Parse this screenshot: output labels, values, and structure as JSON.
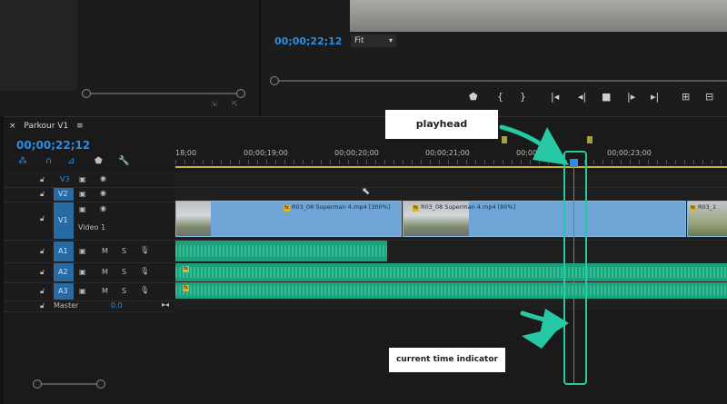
{
  "program_monitor": {
    "timecode": "00;00;22;12",
    "zoom": "Fit",
    "transport_icons": [
      "marker-icon",
      "mark-in-icon",
      "mark-out-icon",
      "go-to-in-icon",
      "step-back-icon",
      "stop-icon",
      "step-forward-icon",
      "go-to-out-icon",
      "lift-icon",
      "extract-icon"
    ]
  },
  "timeline": {
    "sequence_name": "Parkour V1",
    "timecode": "00;00;22;12",
    "ruler_labels": [
      "18;00",
      "00;00;19;00",
      "00;00;20;00",
      "00;00;21;00",
      "00;00;22;00",
      "00;00;23;00"
    ],
    "tracks": [
      {
        "id": "V3",
        "type": "video",
        "label": ""
      },
      {
        "id": "V2",
        "type": "video",
        "label": ""
      },
      {
        "id": "V1",
        "type": "video",
        "label": "Video 1"
      },
      {
        "id": "A1",
        "type": "audio",
        "m": "M",
        "s": "S"
      },
      {
        "id": "A2",
        "type": "audio",
        "m": "M",
        "s": "S"
      },
      {
        "id": "A3",
        "type": "audio",
        "m": "M",
        "s": "S"
      }
    ],
    "master": {
      "label": "Master",
      "value": "0.0"
    },
    "clips": [
      {
        "name": "R03_08 Superman 4.mp4 [300%]"
      },
      {
        "name": "R03_08 Superman 4.mp4 [80%]"
      },
      {
        "name": "R03_1"
      }
    ]
  },
  "annotations": {
    "playhead": "playhead",
    "current_time_indicator": "current time indicator"
  },
  "colors": {
    "accent": "#2b8de8",
    "callout_arrow": "#27c9a4",
    "audio_clip": "#1fa07d",
    "video_clip": "#6fa5d6"
  }
}
